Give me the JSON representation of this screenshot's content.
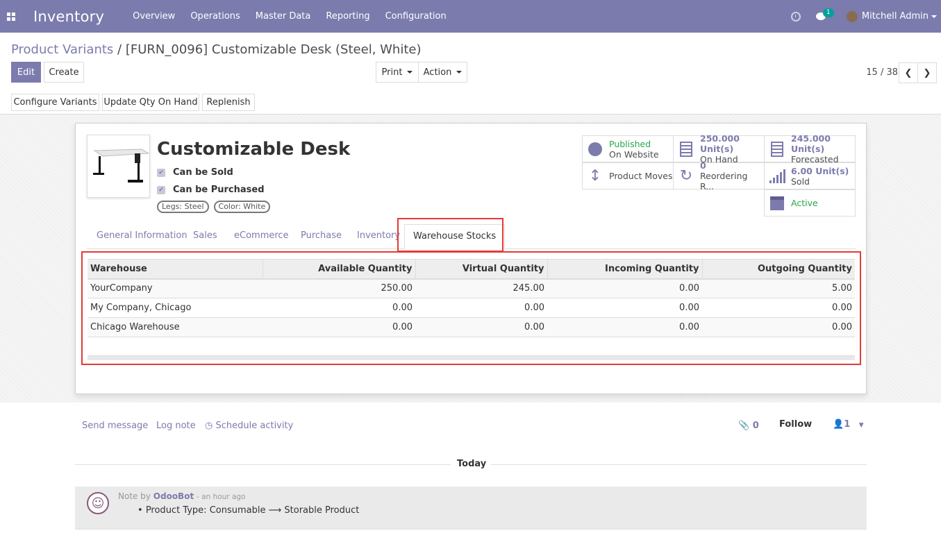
{
  "navbar": {
    "app_name": "Inventory",
    "menu": [
      "Overview",
      "Operations",
      "Master Data",
      "Reporting",
      "Configuration"
    ],
    "chat_badge": "1",
    "user_name": "Mitchell Admin",
    "accent_color": "#7c7bad"
  },
  "breadcrumb": {
    "parent": "Product Variants",
    "separator": "/",
    "current": "[FURN_0096] Customizable Desk (Steel, White)"
  },
  "toolbar": {
    "edit_label": "Edit",
    "create_label": "Create",
    "print_label": "Print",
    "action_label": "Action"
  },
  "pager": {
    "value": "15 / 38",
    "prev_icon": "chevron-left-icon",
    "next_icon": "chevron-right-icon"
  },
  "statusbar": {
    "configure_variants": "Configure Variants",
    "update_qty": "Update Qty On Hand",
    "replenish": "Replenish"
  },
  "product": {
    "name": "Customizable Desk",
    "can_be_sold": "Can be Sold",
    "can_be_purchased": "Can be Purchased",
    "tags": [
      "Legs: Steel",
      "Color: White"
    ]
  },
  "smart_buttons": {
    "published": {
      "line1": "Published",
      "line2": "On Website",
      "icon": "globe-icon"
    },
    "on_hand": {
      "value": "250.000 Unit(s)",
      "label": "On Hand",
      "icon": "building-icon"
    },
    "forecasted": {
      "value": "245.000 Unit(s)",
      "label": "Forecasted",
      "icon": "building-icon"
    },
    "product_moves": {
      "label": "Product Moves",
      "icon": "arrows-v-icon"
    },
    "reordering": {
      "value": "0",
      "label": "Reordering R...",
      "icon": "refresh-icon"
    },
    "sold": {
      "value": "6.00 Unit(s)",
      "label": "Sold",
      "icon": "signal-icon"
    },
    "active": {
      "label": "Active",
      "icon": "archive-icon"
    }
  },
  "tabs": [
    "General Information",
    "Sales",
    "eCommerce",
    "Purchase",
    "Inventory",
    "Warehouse Stocks"
  ],
  "stock_table": {
    "headers": [
      "Warehouse",
      "Available Quantity",
      "Virtual Quantity",
      "Incoming Quantity",
      "Outgoing Quantity"
    ],
    "rows": [
      [
        "YourCompany",
        "250.00",
        "245.00",
        "0.00",
        "5.00"
      ],
      [
        "My Company, Chicago",
        "0.00",
        "0.00",
        "0.00",
        "0.00"
      ],
      [
        "Chicago Warehouse",
        "0.00",
        "0.00",
        "0.00",
        "0.00"
      ]
    ]
  },
  "chatter": {
    "send_message": "Send message",
    "log_note": "Log note",
    "schedule_activity": "Schedule activity",
    "attachments_count": "0",
    "follow": "Follow",
    "followers_count": "1",
    "today": "Today",
    "message": {
      "prefix": "Note by",
      "author": "OdooBot",
      "time": "- an hour ago",
      "body_field": "Product Type:",
      "old_value": "Consumable",
      "arrow": "⟶",
      "new_value": "Storable Product"
    }
  }
}
